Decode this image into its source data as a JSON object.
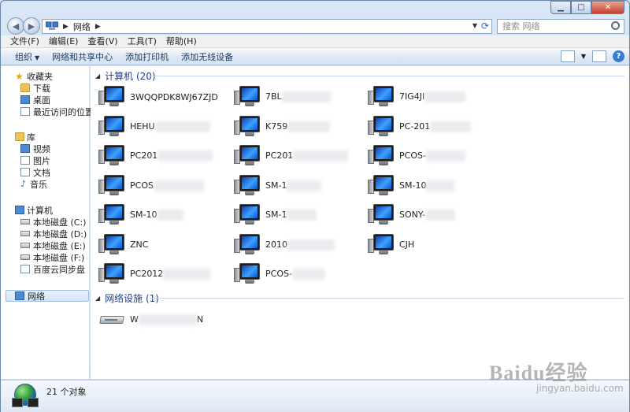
{
  "address": {
    "crumb": "网络"
  },
  "search": {
    "placeholder": "搜索 网络"
  },
  "menubar": {
    "items": [
      "文件(F)",
      "编辑(E)",
      "查看(V)",
      "工具(T)",
      "帮助(H)"
    ]
  },
  "cmdbar": {
    "organize": "组织",
    "network_center": "网络和共享中心",
    "add_printer": "添加打印机",
    "add_wireless": "添加无线设备"
  },
  "nav": {
    "favorites": {
      "label": "收藏夹",
      "items": [
        "下载",
        "桌面",
        "最近访问的位置"
      ]
    },
    "libraries": {
      "label": "库",
      "items": [
        "视频",
        "图片",
        "文档",
        "音乐"
      ]
    },
    "computer": {
      "label": "计算机",
      "items": [
        "本地磁盘 (C:)",
        "本地磁盘 (D:)",
        "本地磁盘 (E:)",
        "本地磁盘 (F:)",
        "百度云同步盘"
      ]
    },
    "network": {
      "label": "网络"
    }
  },
  "groups": {
    "computers": {
      "header": "计算机 (20)",
      "items": [
        "3WQQPDK8WJ67ZJD",
        "7BL",
        "7IG4JI",
        "HEHU",
        "K759",
        "PC-201",
        "PC201",
        "PC201",
        "PCOS-",
        "PCOS",
        "SM-1",
        "SM-10",
        "SM-10",
        "SM-1",
        "SONY-",
        "ZNC",
        "2010",
        "CJH",
        "PC2012",
        "PCOS-"
      ]
    },
    "devices": {
      "header": "网络设施 (1)",
      "items": [
        "W"
      ]
    }
  },
  "status": {
    "count": "21 个对象"
  },
  "watermark": {
    "main": "Baidu经验",
    "sub": "jingyan.baidu.com"
  }
}
